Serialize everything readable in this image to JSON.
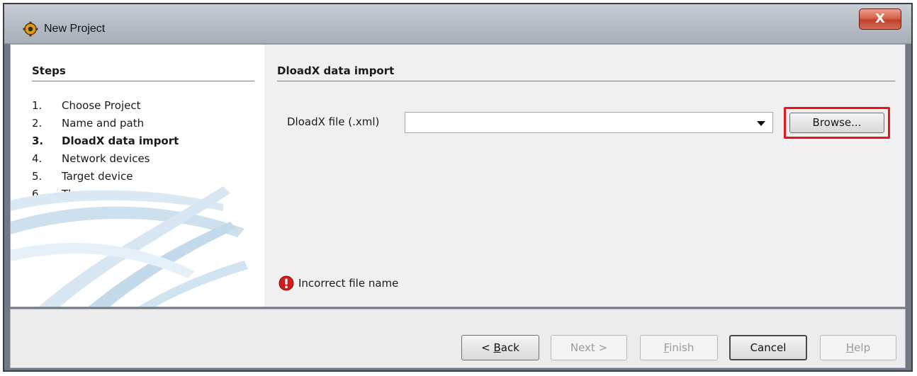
{
  "window": {
    "title": "New Project",
    "close_label": "X"
  },
  "steps": {
    "heading": "Steps",
    "items": [
      {
        "num": "1.",
        "label": "Choose Project",
        "current": false
      },
      {
        "num": "2.",
        "label": "Name and path",
        "current": false
      },
      {
        "num": "3.",
        "label": "DloadX data import",
        "current": true
      },
      {
        "num": "4.",
        "label": "Network devices",
        "current": false
      },
      {
        "num": "5.",
        "label": "Target device",
        "current": false
      },
      {
        "num": "6.",
        "label": "Theme",
        "current": false
      }
    ]
  },
  "main": {
    "heading": "DloadX data import",
    "file_label": "DloadX file (.xml)",
    "file_value": "",
    "browse_label": "Browse...",
    "error_text": "Incorrect file name"
  },
  "footer": {
    "back": {
      "mnemonic": "B",
      "rest": "ack",
      "prefix": "< "
    },
    "next": "Next >",
    "finish": {
      "mnemonic": "F",
      "rest": "inish"
    },
    "cancel": "Cancel",
    "help": {
      "mnemonic": "H",
      "rest": "elp"
    }
  },
  "colors": {
    "highlight_border": "#e8141c",
    "error_icon": "#d11c1c",
    "close_button": "#c94a33"
  }
}
